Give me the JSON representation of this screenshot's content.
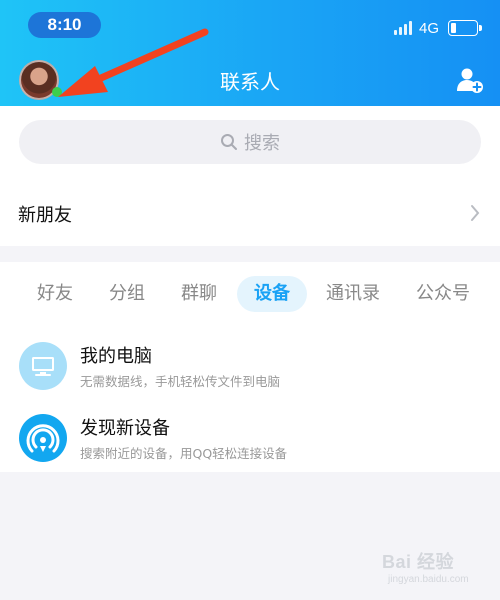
{
  "status_bar": {
    "time": "8:10",
    "network": "4G"
  },
  "header": {
    "title": "联系人",
    "icons": {
      "avatar": "avatar",
      "add_friend": "add-friend-icon"
    }
  },
  "search": {
    "placeholder": "搜索"
  },
  "new_friends": {
    "label": "新朋友"
  },
  "tabs": [
    {
      "label": "好友",
      "active": false
    },
    {
      "label": "分组",
      "active": false
    },
    {
      "label": "群聊",
      "active": false
    },
    {
      "label": "设备",
      "active": true
    },
    {
      "label": "通讯录",
      "active": false
    },
    {
      "label": "公众号",
      "active": false
    }
  ],
  "devices": [
    {
      "title": "我的电脑",
      "subtitle": "无需数据线，手机轻松传文件到电脑",
      "icon": "computer-icon"
    },
    {
      "title": "发现新设备",
      "subtitle": "搜索附近的设备，用QQ轻松连接设备",
      "icon": "find-device-icon"
    }
  ],
  "watermark": {
    "text": "Bai 经验",
    "sub": "jingyan.baidu.com"
  },
  "colors": {
    "header_start": "#1fc4f7",
    "header_end": "#1590f4",
    "accent": "#1aa2f5",
    "annotation_arrow": "#f2421f"
  }
}
